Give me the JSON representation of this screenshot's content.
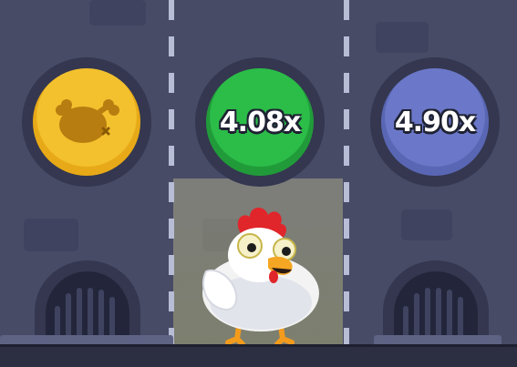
{
  "lanes": [
    {
      "kind": "collected",
      "color": "#f3c12e",
      "icon": "chicken-bones-icon"
    },
    {
      "kind": "multiplier",
      "label": "4.08x",
      "color": "#2bbd48",
      "state": "current"
    },
    {
      "kind": "multiplier",
      "label": "4.90x",
      "color": "#6b78c9",
      "state": "next"
    }
  ],
  "player": {
    "icon": "chicken-icon"
  }
}
